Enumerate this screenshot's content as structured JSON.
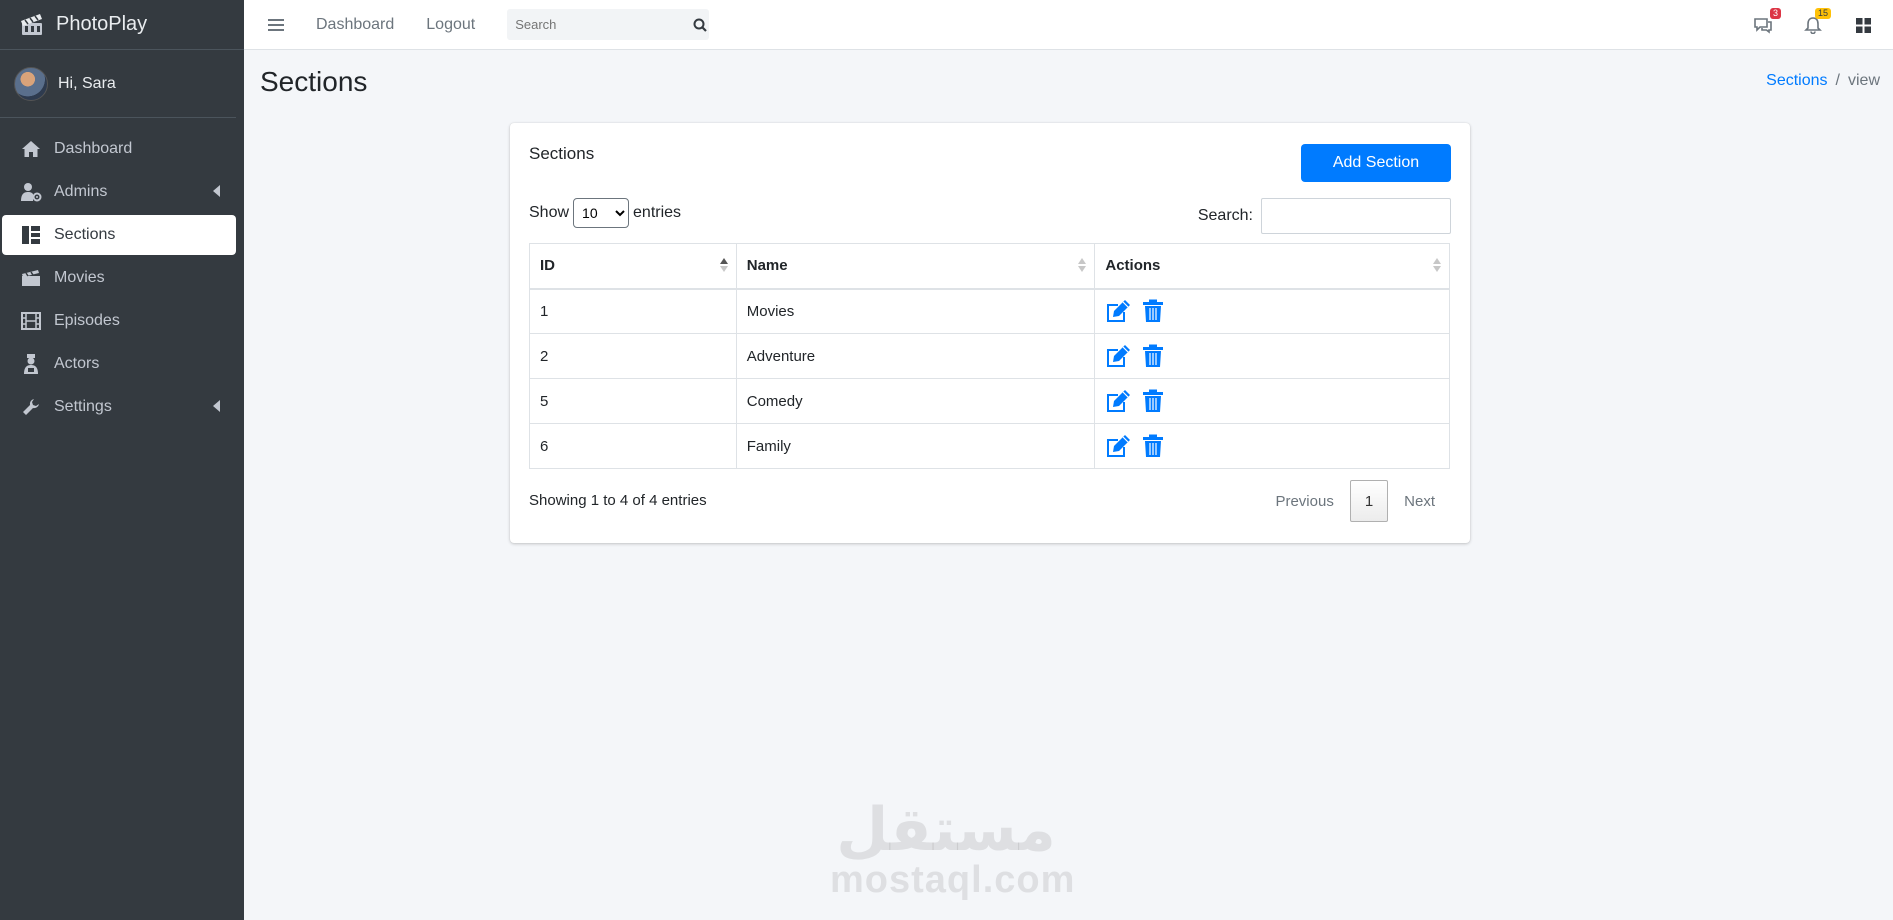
{
  "brand": {
    "name": "PhotoPlay"
  },
  "user": {
    "greeting": "Hi, Sara"
  },
  "sidebar": {
    "items": [
      {
        "label": "Dashboard",
        "icon": "home-icon"
      },
      {
        "label": "Admins",
        "icon": "user-gear-icon",
        "has_submenu": true
      },
      {
        "label": "Sections",
        "icon": "sections-icon",
        "active": true
      },
      {
        "label": "Movies",
        "icon": "clapperboard-icon"
      },
      {
        "label": "Episodes",
        "icon": "film-strip-icon"
      },
      {
        "label": "Actors",
        "icon": "actor-icon"
      },
      {
        "label": "Settings",
        "icon": "wrench-icon",
        "has_submenu": true
      }
    ]
  },
  "topbar": {
    "links": [
      "Dashboard",
      "Logout"
    ],
    "search_placeholder": "Search",
    "messages_count": "3",
    "notifications_count": "15"
  },
  "page": {
    "title": "Sections",
    "breadcrumb": {
      "link": "Sections",
      "current": "view"
    }
  },
  "card": {
    "title": "Sections",
    "add_button": "Add Section",
    "show_label": "Show",
    "entries_label": "entries",
    "page_length": "10",
    "search_label": "Search:",
    "columns": [
      "ID",
      "Name",
      "Actions"
    ],
    "rows": [
      {
        "id": "1",
        "name": "Movies"
      },
      {
        "id": "2",
        "name": "Adventure"
      },
      {
        "id": "5",
        "name": "Comedy"
      },
      {
        "id": "6",
        "name": "Family"
      }
    ],
    "info": "Showing 1 to 4 of 4 entries",
    "pager": {
      "previous": "Previous",
      "current": "1",
      "next": "Next"
    }
  },
  "watermark": {
    "arabic": "مستقل",
    "latin": "mostaql.com"
  },
  "colors": {
    "sidebar": "#343a40",
    "primary": "#007bff",
    "background": "#f4f6f9"
  }
}
